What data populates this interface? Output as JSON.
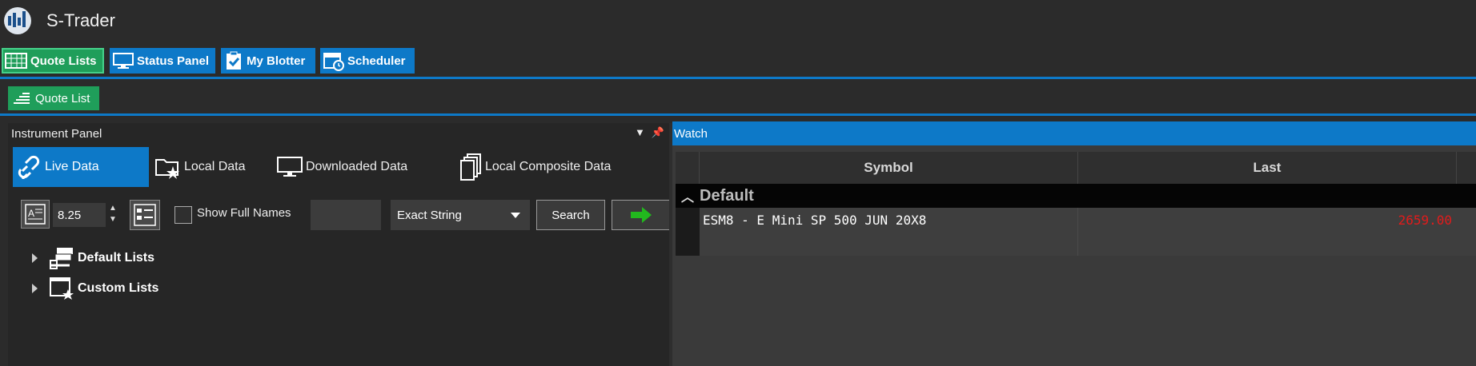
{
  "app": {
    "title": "S-Trader"
  },
  "ribbon": {
    "tabs": [
      {
        "label": "Quote Lists",
        "icon": "grid-icon",
        "active": true
      },
      {
        "label": "Status Panel",
        "icon": "monitor-icon",
        "active": false
      },
      {
        "label": "My Blotter",
        "icon": "clipboard-check-icon",
        "active": false
      },
      {
        "label": "Scheduler",
        "icon": "calendar-clock-icon",
        "active": false
      }
    ],
    "sub_button": {
      "label": "Quote List",
      "icon": "bars-icon"
    }
  },
  "instrument_panel": {
    "title": "Instrument Panel",
    "header_icons": [
      "dropdown-icon",
      "pin-icon"
    ],
    "tabs": [
      {
        "label": "Live Data",
        "icon": "link-icon",
        "active": true
      },
      {
        "label": "Local Data",
        "icon": "folder-star-icon",
        "active": false
      },
      {
        "label": "Downloaded Data",
        "icon": "monitor-icon",
        "active": false
      },
      {
        "label": "Local Composite Data",
        "icon": "documents-stack-icon",
        "active": false
      }
    ],
    "toolbar": {
      "font_size": "8.25",
      "show_full_names_label": "Show Full Names",
      "show_full_names_checked": false,
      "filter_value": "",
      "match_mode": "Exact String",
      "search_label": "Search",
      "go_icon": "green-arrow-right-icon"
    },
    "tree": [
      {
        "label": "Default Lists",
        "icon": "stacked-lists-icon"
      },
      {
        "label": "Custom Lists",
        "icon": "window-star-icon"
      }
    ]
  },
  "watch": {
    "title": "Watch",
    "columns": [
      "Symbol",
      "Last"
    ],
    "group": "Default",
    "rows": [
      {
        "symbol": "ESM8 - E Mini SP 500 JUN 20X8",
        "last": "2659.00"
      },
      {
        "symbol": "",
        "last": ""
      }
    ],
    "last_color": "#e21b1b"
  },
  "colors": {
    "accent_blue": "#0d79c8",
    "accent_green": "#1f9e5a",
    "background": "#2b2b2b"
  }
}
